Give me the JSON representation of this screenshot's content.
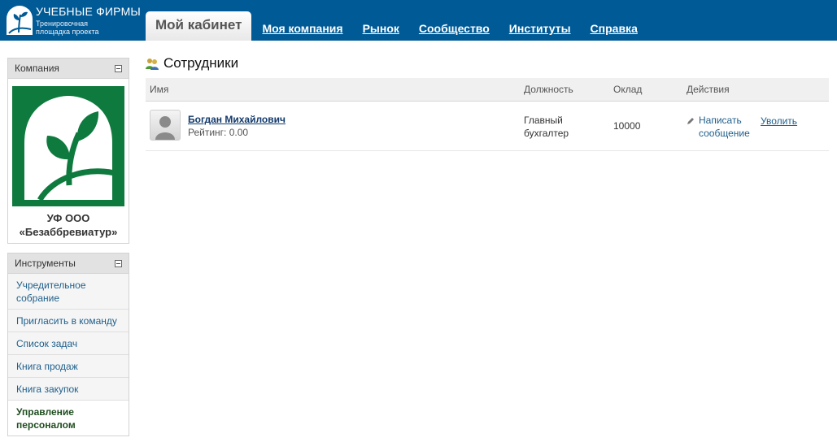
{
  "header": {
    "logo_title": "УЧЕБНЫЕ ФИРМЫ",
    "logo_sub_1": "Тренировочная",
    "logo_sub_2": "площадка проекта",
    "active_tab": "Мой кабинет",
    "nav": [
      "Моя компания",
      "Рынок",
      "Сообщество",
      "Институты",
      "Справка"
    ]
  },
  "sidebar": {
    "company_header": "Компания",
    "company_name_1": "УФ ООО",
    "company_name_2": "«Безаббревиатур»",
    "tools_header": "Инструменты",
    "tools": [
      {
        "label": "Учредительное собрание"
      },
      {
        "label": "Пригласить в команду"
      },
      {
        "label": "Список задач"
      },
      {
        "label": "Книга продаж"
      },
      {
        "label": "Книга закупок"
      },
      {
        "label": "Управление персоналом"
      }
    ]
  },
  "main": {
    "title": "Сотрудники",
    "columns": [
      "Имя",
      "Должность",
      "Оклад",
      "Действия"
    ],
    "rows": [
      {
        "name": "Богдан Михайлович",
        "rating": "Рейтинг: 0.00",
        "position": "Главный бухгалтер",
        "salary": "10000",
        "message_action": "Написать сообщение",
        "fire_action": "Уволить"
      }
    ]
  },
  "colors": {
    "topbar": "#005a96",
    "logo_green": "#0f7a3e",
    "link": "#1f5f8b"
  }
}
